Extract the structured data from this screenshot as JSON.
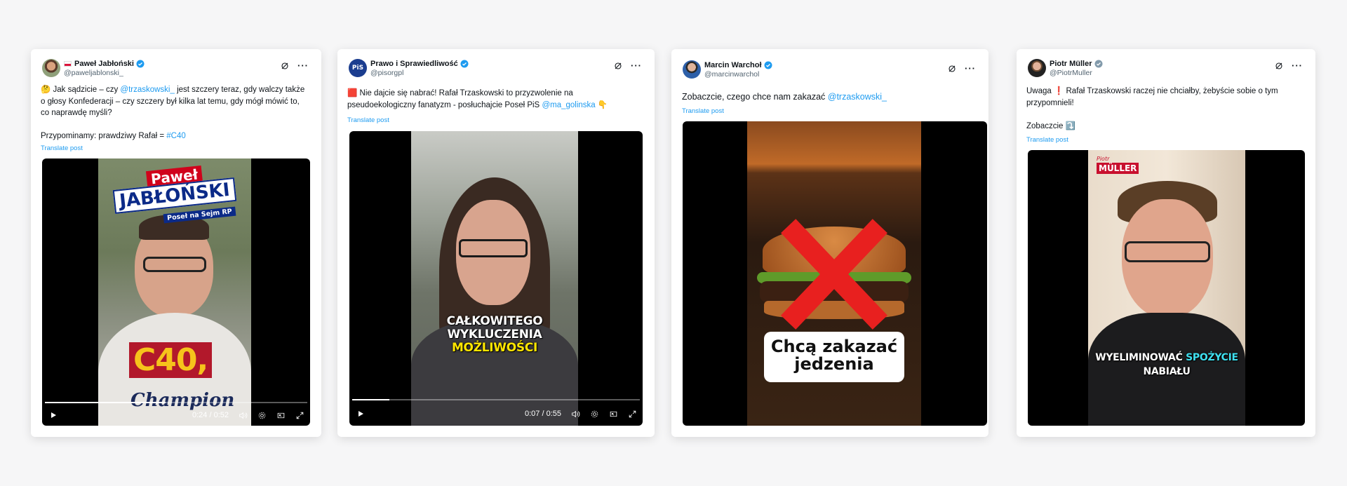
{
  "posts": [
    {
      "author": "Paweł Jabłoński",
      "handle": "@paweljablonski_",
      "text_lines": [
        {
          "parts": [
            {
              "t": "🤔 Jak sądzicie – czy "
            },
            {
              "t": "@trzaskowski_",
              "link": true
            },
            {
              "t": " jest szczery teraz, gdy walczy także"
            }
          ]
        },
        {
          "parts": [
            {
              "t": "o głosy Konfederacji – czy szczery był kilka lat temu, gdy mógł mówić to,"
            }
          ]
        },
        {
          "parts": [
            {
              "t": "co naprawdę myśli?"
            }
          ]
        },
        {
          "parts": [
            {
              "t": " "
            }
          ]
        },
        {
          "parts": [
            {
              "t": "Przypominamy: prawdziwy Rafał = "
            },
            {
              "t": "#C40",
              "link": true
            }
          ]
        }
      ],
      "translate": "Translate post",
      "video": {
        "time": "0:24 / 0:52",
        "progress": 0.46,
        "overlay_top_line1": "Paweł",
        "overlay_top_line2": "JABŁOŃSKI",
        "overlay_top_line3": "Poseł na Sejm RP",
        "overlay_big": "C40,",
        "overlay_bottom": "Champion"
      }
    },
    {
      "author": "Prawo i Sprawiedliwość",
      "handle": "@pisorgpl",
      "avatar_text": "PiS",
      "text_lines": [
        {
          "parts": [
            {
              "t": "🟥 Nie dajcie się nabrać! Rafał Trzaskowski to przyzwolenie na"
            }
          ]
        },
        {
          "parts": [
            {
              "t": "pseudoekologiczny fanatyzm - posłuchajcie Poseł PiS "
            },
            {
              "t": "@ma_golinska",
              "link": true
            },
            {
              "t": " 👇"
            }
          ]
        }
      ],
      "translate": "Translate post",
      "video": {
        "time": "0:07 / 0:55",
        "progress": 0.13,
        "caption_line1": "CAŁKOWITEGO",
        "caption_line2": "WYKLUCZENIA",
        "caption_line3": "MOŻLIWOŚCI"
      }
    },
    {
      "author": "Marcin Warchoł",
      "handle": "@marcinwarchol",
      "text_lines": [
        {
          "parts": [
            {
              "t": "Zobaczcie, czego chce nam zakazać "
            },
            {
              "t": "@trzaskowski_",
              "link": true
            }
          ]
        }
      ],
      "translate": "Translate post",
      "video": {
        "caption_line1": "Chcą zakazać",
        "caption_line2": "jedzenia"
      }
    },
    {
      "author": "Piotr Müller",
      "handle": "@PiotrMuller",
      "text_lines": [
        {
          "parts": [
            {
              "t": "Uwaga ❗ Rafał Trzaskowski raczej nie chciałby, żebyście sobie o tym"
            }
          ]
        },
        {
          "parts": [
            {
              "t": "przypomnieli!"
            }
          ]
        },
        {
          "parts": [
            {
              "t": " "
            }
          ]
        },
        {
          "parts": [
            {
              "t": "Zobaczcie ⤵️"
            }
          ]
        }
      ],
      "translate": "Translate post",
      "video": {
        "logo_small": "Piotr",
        "logo_big": "MÜLLER",
        "caption_a": "WYELIMINOWAĆ ",
        "caption_b": "SPOŻYCIE",
        "caption_line2": "NABIAŁU"
      }
    }
  ],
  "colors": {
    "link": "#1d9bf0",
    "verified": "#1d9bf0",
    "caption_highlight": "#ffe600"
  }
}
